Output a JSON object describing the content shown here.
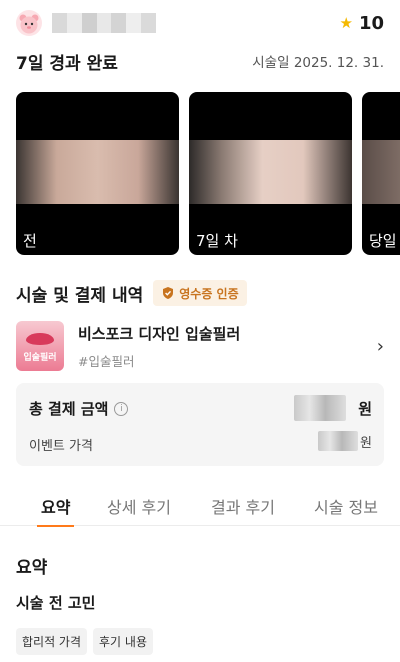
{
  "header": {
    "rating": "10",
    "star_icon": "star-icon"
  },
  "result": {
    "title": "7일 경과 완료",
    "date": "시술일 2025. 12. 31."
  },
  "photos": [
    {
      "caption": "전"
    },
    {
      "caption": "7일 차"
    },
    {
      "caption": "당일"
    }
  ],
  "treatment": {
    "section_title": "시술 및 결제 내역",
    "receipt_badge": "영수증 인증",
    "product_name": "비스포크 디자인 입술필러",
    "product_tag": "#입술필러",
    "product_thumb_label": "입술필러"
  },
  "payment": {
    "total_label": "총 결제 금액",
    "total_currency": "원",
    "event_label": "이벤트 가격",
    "event_currency": "원"
  },
  "tabs": [
    {
      "label": "요약"
    },
    {
      "label": "상세 후기"
    },
    {
      "label": "결과 후기"
    },
    {
      "label": "시술 정보"
    }
  ],
  "summary": {
    "heading": "요약",
    "concern_heading": "시술 전 고민",
    "chips": [
      "합리적 가격",
      "후기 내용"
    ]
  },
  "colors": {
    "accent": "#ff7a1a",
    "star": "#f5b900",
    "badge_text": "#c8741f",
    "badge_bg": "#fbf1e4"
  }
}
